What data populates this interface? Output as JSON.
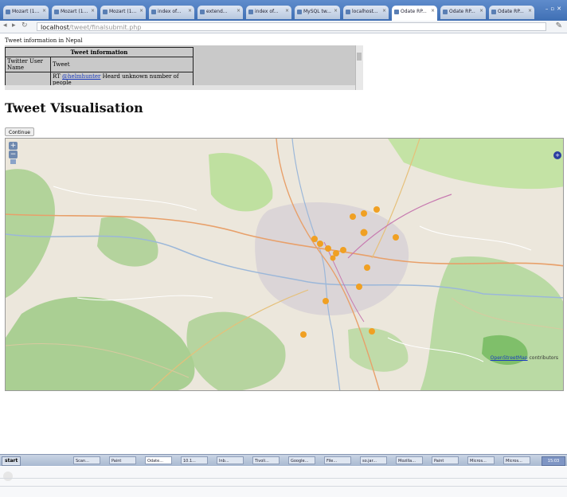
{
  "browser": {
    "tabs": [
      {
        "label": "Mozart (1..."
      },
      {
        "label": "Mozart (1..."
      },
      {
        "label": "Mozart (1..."
      },
      {
        "label": "index of..."
      },
      {
        "label": "extend..."
      },
      {
        "label": "index of..."
      },
      {
        "label": "MySQL tw..."
      },
      {
        "label": "localhost..."
      },
      {
        "label": "Odate RP..."
      },
      {
        "label": "Odate RP..."
      },
      {
        "label": "Odate RP..."
      }
    ],
    "active_tab_index": 8,
    "address_host": "localhost",
    "address_path": "/tweet/finalsubmit.php"
  },
  "page": {
    "info_caption": "Tweet information in Nepal",
    "table": {
      "header": "Tweet information",
      "rows": [
        {
          "label": "Twitter User Name",
          "value": "Tweet"
        },
        {
          "label": "",
          "value_link": "@helmhunter",
          "value_prefix": "RT ",
          "value_rest": " Heard unknown number of people"
        }
      ]
    },
    "title": "Tweet Visualisation",
    "continue_label": "Continue"
  },
  "map": {
    "zoom_in": "+",
    "zoom_out": "−",
    "credit_link": "OpenStreetMap",
    "credit_suffix": " contributors",
    "layer_switch": "+"
  },
  "taskbar": {
    "start_label": "start",
    "items": [
      "Scan...",
      "Paint",
      "Odate...",
      "10.1...",
      "Inb...",
      "Tivoli...",
      "Google...",
      "File...",
      "so.jar...",
      "Mozilla...",
      "Paint",
      "Micros...",
      "Micros..."
    ],
    "active_index": 2,
    "tray": "15:03"
  }
}
